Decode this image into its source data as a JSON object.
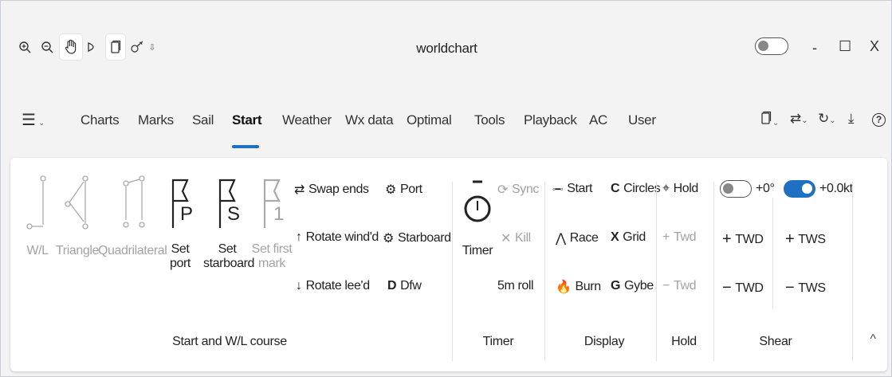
{
  "window": {
    "title": "worldchart"
  },
  "quick_access": [
    {
      "icon": "zoom-in-icon",
      "glyph": "⊕"
    },
    {
      "icon": "zoom-out-icon",
      "glyph": "⊖"
    },
    {
      "icon": "hand-pan-icon",
      "glyph": "✋"
    },
    {
      "icon": "boat-icon",
      "glyph": "▷"
    },
    {
      "icon": "device-icon",
      "glyph": "▯"
    },
    {
      "icon": "satellite-icon",
      "glyph": "⚲"
    },
    {
      "icon": "customize-dropdown-icon",
      "glyph": "⇩"
    }
  ],
  "window_controls": {
    "minimize": "-",
    "maximize": "☐",
    "close": "X"
  },
  "menu_button": "☰",
  "tabs": [
    {
      "label": "Charts"
    },
    {
      "label": "Marks"
    },
    {
      "label": "Sail"
    },
    {
      "label": "Start"
    },
    {
      "label": "Weather"
    },
    {
      "label": "Wx data"
    },
    {
      "label": "Optimal"
    },
    {
      "label": "Tools"
    },
    {
      "label": "Playback"
    },
    {
      "label": "AC"
    },
    {
      "label": "User"
    }
  ],
  "right_tools": {
    "help": "?"
  },
  "groups": {
    "start_wl": {
      "label": "Start and W/L course",
      "wl": "W/L",
      "triangle": "Triangle",
      "quadrilateral": "Quadrilateral",
      "set_port": [
        "Set",
        "port"
      ],
      "set_starboard": [
        "Set",
        "starboard"
      ],
      "set_first_mark": [
        "Set first",
        "mark"
      ],
      "swap_ends": "Swap ends",
      "rotate_windward": "Rotate wind'd",
      "rotate_leeward": "Rotate lee'd",
      "port": "Port",
      "starboard": "Starboard",
      "dfw_key": "D",
      "dfw": "Dfw",
      "icon_letters": {
        "port_sub": "P",
        "starboard_sub": "S",
        "first_sub": "1"
      }
    },
    "timer": {
      "label": "Timer",
      "timer": "Timer",
      "sync": "Sync",
      "kill": "Kill",
      "roll": "5m roll"
    },
    "display": {
      "label": "Display",
      "start": "Start",
      "race": "Race",
      "burn": "Burn",
      "circles_key": "C",
      "circles": "Circles",
      "grid_key": "X",
      "grid": "Grid",
      "gybe_key": "G",
      "gybe": "Gybe"
    },
    "hold": {
      "label": "Hold",
      "hold": "Hold",
      "twd_plus": "Twd",
      "twd_minus": "Twd"
    },
    "shear": {
      "label": "Shear",
      "twd_offset": "+0°",
      "tws_offset": "+0.0kt",
      "plus_twd": "TWD",
      "plus_tws": "TWS",
      "minus_twd": "TWD",
      "minus_tws": "TWS"
    }
  },
  "colors": {
    "accent": "#1f6fc2",
    "disabled": "#a3a3a3"
  }
}
